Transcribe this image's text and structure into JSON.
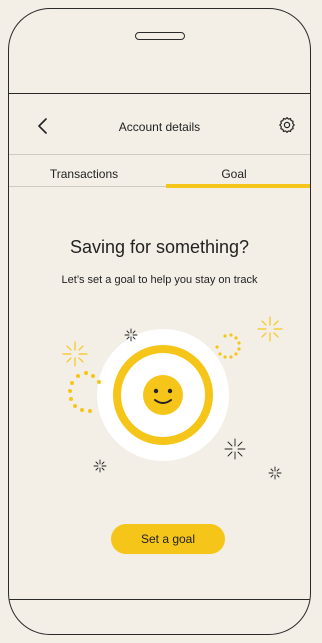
{
  "header": {
    "title": "Account details",
    "back_icon": "chevron-left-icon",
    "settings_icon": "gear-icon"
  },
  "tabs": [
    {
      "label": "Transactions",
      "active": false
    },
    {
      "label": "Goal",
      "active": true
    }
  ],
  "main": {
    "headline": "Saving for something?",
    "subline": "Let’s set a goal to help you stay on track",
    "illustration_icon": "smiley-face-icon",
    "cta_label": "Set a goal"
  },
  "colors": {
    "background": "#f3efe6",
    "accent": "#f6c519",
    "text": "#222222",
    "divider": "#cfcac0"
  }
}
